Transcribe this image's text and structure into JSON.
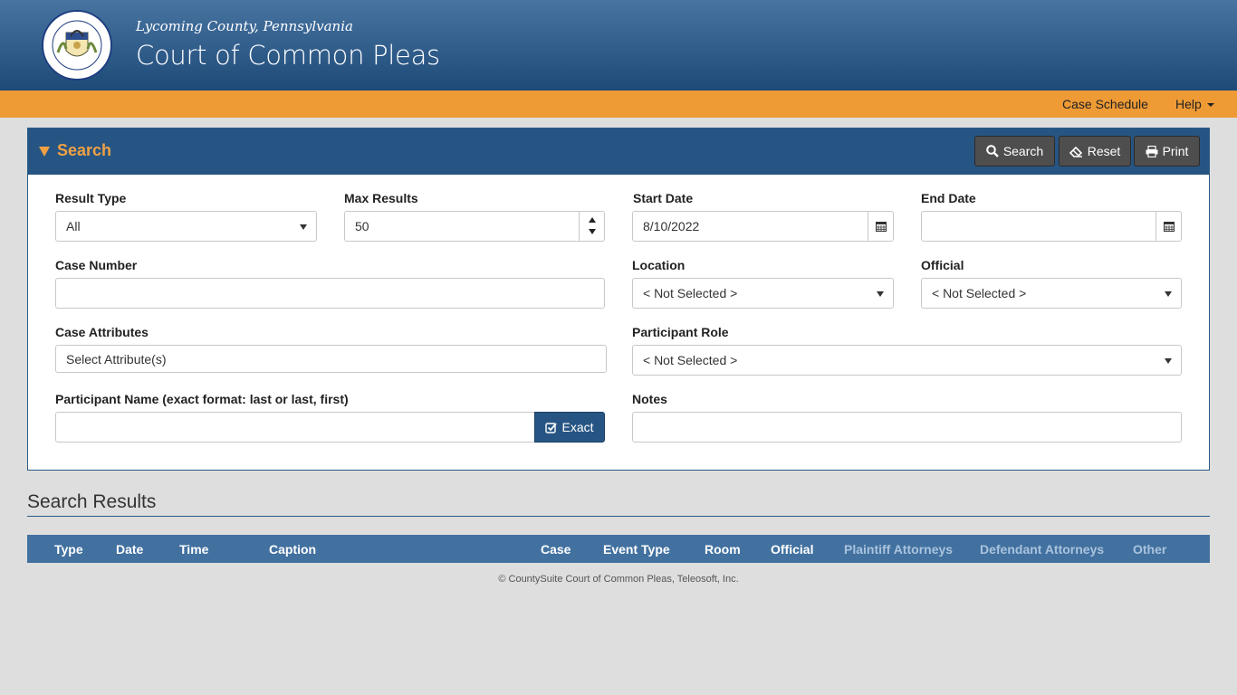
{
  "header": {
    "seal_text": "COUNTY OF LYCOMING PENNSYLVANIA",
    "county": "Lycoming County, Pennsylvania",
    "title": "Court of Common Pleas"
  },
  "nav": {
    "case_schedule": "Case Schedule",
    "help": "Help"
  },
  "search_panel": {
    "title": "Search",
    "buttons": {
      "search": "Search",
      "reset": "Reset",
      "print": "Print"
    },
    "fields": {
      "result_type": {
        "label": "Result Type",
        "value": "All"
      },
      "max_results": {
        "label": "Max Results",
        "value": "50"
      },
      "start_date": {
        "label": "Start Date",
        "value": "8/10/2022"
      },
      "end_date": {
        "label": "End Date",
        "value": ""
      },
      "case_number": {
        "label": "Case Number",
        "value": ""
      },
      "location": {
        "label": "Location",
        "value": "< Not Selected >"
      },
      "official": {
        "label": "Official",
        "value": "< Not Selected >"
      },
      "case_attributes": {
        "label": "Case Attributes",
        "placeholder": "Select Attribute(s)"
      },
      "participant_role": {
        "label": "Participant Role",
        "value": "< Not Selected >"
      },
      "participant_name": {
        "label": "Participant Name (exact format: last or last, first)",
        "value": ""
      },
      "exact_button": "Exact",
      "notes": {
        "label": "Notes",
        "value": ""
      }
    }
  },
  "results": {
    "title": "Search Results",
    "columns": [
      "Type",
      "Date",
      "Time",
      "Caption",
      "Case",
      "Event Type",
      "Room",
      "Official",
      "Plaintiff Attorneys",
      "Defendant Attorneys",
      "Other"
    ]
  },
  "footer": "© CountySuite Court of Common Pleas, Teleosoft, Inc.",
  "colors": {
    "header_blue": "#275583",
    "nav_orange": "#ee9a35",
    "accent_orange": "#f0a144",
    "table_header": "#4271a0"
  }
}
